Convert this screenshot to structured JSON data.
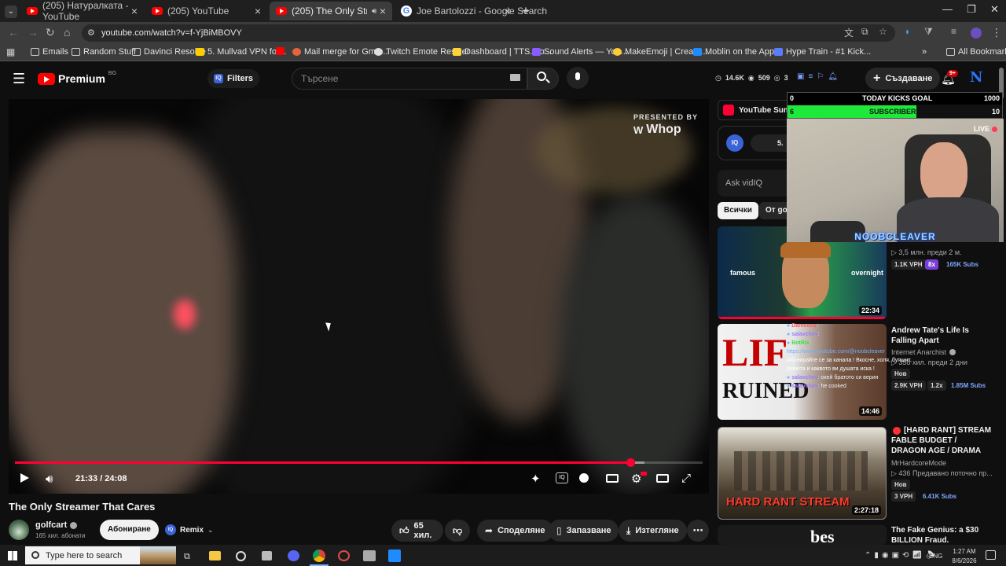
{
  "browser": {
    "tabs": [
      {
        "title": "(205) Натуралката - YouTube",
        "active": false
      },
      {
        "title": "(205) YouTube",
        "active": false
      },
      {
        "title": "(205) The Only Streamer Th",
        "active": true
      },
      {
        "title": "Joe Bartolozzi - Google Search",
        "active": false
      }
    ],
    "url": "youtube.com/watch?v=f-YjBiMBOVY",
    "bookmarks": [
      {
        "label": "Emails",
        "icon": "folder-icon"
      },
      {
        "label": "Random Stuff",
        "icon": "folder-icon"
      },
      {
        "label": "Davinci Resolve",
        "icon": "folder-icon"
      },
      {
        "label": "5. Mullvad VPN for...",
        "icon": "mullvad-icon"
      },
      {
        "label": "",
        "icon": "youtube-icon"
      },
      {
        "label": "Mail merge for Gma...",
        "icon": "mail-icon"
      },
      {
        "label": "Twitch Emote Resizer",
        "icon": "resize-icon"
      },
      {
        "label": "Dashboard | TTS.Mo...",
        "icon": "dashboard-icon"
      },
      {
        "label": "Sound Alerts — You...",
        "icon": "sound-icon"
      },
      {
        "label": "MakeEmoji | Create...",
        "icon": "emoji-icon"
      },
      {
        "label": "Moblin on the App...",
        "icon": "appstore-icon"
      },
      {
        "label": "Hype Train - #1 Kick...",
        "icon": "shield-icon"
      }
    ],
    "all_bookmarks": "All Bookmarks"
  },
  "yt": {
    "premium": "Premium",
    "region": "BG",
    "filters": "Filters",
    "search_placeholder": "Търсене",
    "stats": {
      "subs": "14.6K",
      "videos": "509",
      "views": "3"
    },
    "create": "Създаване",
    "notif_count": "9+"
  },
  "player": {
    "time": "21:33 / 24:08",
    "progress": 0.895,
    "buffer": 0.915,
    "sponsor_top": "PRESENTED BY",
    "sponsor_brand": "Whop"
  },
  "video": {
    "title": "The Only Streamer That Cares",
    "channel": "golfcart",
    "subscribers": "165 хил. абонати",
    "subscribe": "Абониране",
    "remix": "Remix",
    "likes": "65 хил.",
    "share": "Споделяне",
    "save": "Запазване",
    "download": "Изтегляне"
  },
  "sidebar": {
    "header": "YouTube Sum",
    "iq_value": "5.",
    "ask": "Ask vidIQ",
    "chips": [
      "Всички",
      "От gol"
    ],
    "videos": [
      {
        "duration": "22:34",
        "thumb_left": "famous",
        "thumb_right": "overnight",
        "meta": "▷ 3,5 млн.  преди 2 м.",
        "vph": "1.1K VPH",
        "mult": "8x",
        "subs": "165K Subs"
      },
      {
        "duration": "14:46",
        "title": "Andrew Tate's Life Is Falling Apart",
        "channel": "Internet Anarchist",
        "meta": "▷ 358 хил.  преди 2 дни",
        "new": "Нов",
        "vph": "2.9K VPH",
        "mult": "1.2x",
        "subs": "1.85M Subs",
        "thumb_text_1": "LIF",
        "thumb_text_2": "RUINED"
      },
      {
        "duration": "2:27:18",
        "title": "[HARD RANT] STREAM FABLE BUDGET / DRAGON AGE / DRAMA",
        "channel": "MrHardcoreMode",
        "meta": "▷ 436  Предавано поточно пр...",
        "new": "Нов",
        "vph": "3 VPH",
        "subs": "6.41K Subs",
        "thumb_text": "HARD RANT STREAM"
      },
      {
        "title": "The Fake Genius: a $30 BILLION Fraud.",
        "thumb_text": "bes"
      }
    ]
  },
  "overlay": {
    "goal1_left": "0",
    "goal1_label": "TODAY KICKS GOAL",
    "goal1_right": "1000",
    "goal2_left": "6",
    "goal2_label": "SUBSCRIBERS",
    "goal2_right": "10",
    "live": "LIVE",
    "cam_name": "NOOBCLEAVER",
    "chat": [
      {
        "user": "Danmons",
        "msg": ":",
        "color": "#ff5a5a"
      },
      {
        "user": "salavchev",
        "msg": ":",
        "color": "#9a7cff"
      },
      {
        "user": "BotRix",
        "msg": ":",
        "color": "#37e04a"
      },
      {
        "user": "",
        "msg": "https://www.youtube.com/@noobcleaver",
        "color": "#6fb1ff"
      },
      {
        "user": "",
        "msg": "Абонирайте се за канала ! Вкосне, холя, бупшит, ревюта и каквото ви душата иска !",
        "color": "#ffffff"
      },
      {
        "user": "salavchev",
        "msg": ": окей братото си верия",
        "color": "#9a7cff"
      },
      {
        "user": "salavchev",
        "msg": ": he cooked",
        "color": "#9a7cff"
      }
    ]
  },
  "taskbar": {
    "search": "Type here to search",
    "lang": "ENG",
    "time": "1:27 AM",
    "date": "8/6/2026"
  }
}
